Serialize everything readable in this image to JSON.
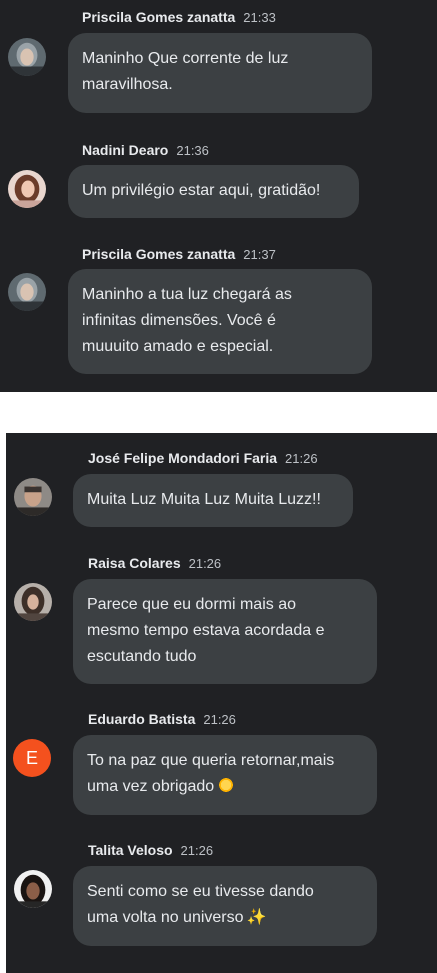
{
  "colors": {
    "panel": "#202124",
    "bubble": "#3c4043",
    "text": "#e8eaed",
    "time": "#bdc1c6",
    "avatar_letter_bg": "#f4511e"
  },
  "chat_top": {
    "messages": [
      {
        "author": "Priscila Gomes zanatta",
        "time": "21:33",
        "avatar": "photo",
        "lines": [
          "Maninho Que corrente de luz",
          "maravilhosa."
        ]
      },
      {
        "author": "Nadini Dearo",
        "time": "21:36",
        "avatar": "photo",
        "lines": [
          "Um privilégio estar aqui, gratidão!"
        ]
      },
      {
        "author": "Priscila Gomes zanatta",
        "time": "21:37",
        "avatar": "photo",
        "lines": [
          "Maninho a tua luz chegará as",
          "infinitas dimensões. Você é",
          "muuuito amado e especial."
        ]
      }
    ]
  },
  "chat_bottom": {
    "messages": [
      {
        "author": "José Felipe Mondadori Faria",
        "time": "21:26",
        "avatar": "photo",
        "lines": [
          "Muita Luz Muita Luz Muita Luzz!!"
        ]
      },
      {
        "author": "Raisa Colares",
        "time": "21:26",
        "avatar": "photo",
        "lines": [
          "Parece que eu dormi mais ao",
          "mesmo tempo estava acordada e",
          "escutando tudo"
        ]
      },
      {
        "author": "Eduardo Batista",
        "time": "21:26",
        "avatar": "letter",
        "avatar_letter": "E",
        "lines": [
          "To na paz que queria retornar,mais",
          "uma vez obrigado"
        ],
        "emoji": "sun-emoji"
      },
      {
        "author": "Talita Veloso",
        "time": "21:26",
        "avatar": "photo",
        "lines": [
          "Senti como se eu tivesse dando",
          "uma volta no universo"
        ],
        "emoji": "sparkles-emoji"
      }
    ]
  }
}
